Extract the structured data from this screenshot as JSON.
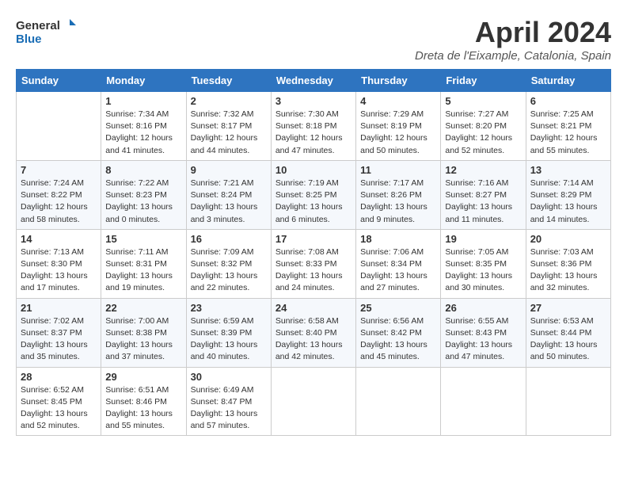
{
  "header": {
    "logo_line1": "General",
    "logo_line2": "Blue",
    "month_title": "April 2024",
    "location": "Dreta de l'Eixample, Catalonia, Spain"
  },
  "days_of_week": [
    "Sunday",
    "Monday",
    "Tuesday",
    "Wednesday",
    "Thursday",
    "Friday",
    "Saturday"
  ],
  "weeks": [
    [
      {
        "day": "",
        "sunrise": "",
        "sunset": "",
        "daylight": ""
      },
      {
        "day": "1",
        "sunrise": "Sunrise: 7:34 AM",
        "sunset": "Sunset: 8:16 PM",
        "daylight": "Daylight: 12 hours and 41 minutes."
      },
      {
        "day": "2",
        "sunrise": "Sunrise: 7:32 AM",
        "sunset": "Sunset: 8:17 PM",
        "daylight": "Daylight: 12 hours and 44 minutes."
      },
      {
        "day": "3",
        "sunrise": "Sunrise: 7:30 AM",
        "sunset": "Sunset: 8:18 PM",
        "daylight": "Daylight: 12 hours and 47 minutes."
      },
      {
        "day": "4",
        "sunrise": "Sunrise: 7:29 AM",
        "sunset": "Sunset: 8:19 PM",
        "daylight": "Daylight: 12 hours and 50 minutes."
      },
      {
        "day": "5",
        "sunrise": "Sunrise: 7:27 AM",
        "sunset": "Sunset: 8:20 PM",
        "daylight": "Daylight: 12 hours and 52 minutes."
      },
      {
        "day": "6",
        "sunrise": "Sunrise: 7:25 AM",
        "sunset": "Sunset: 8:21 PM",
        "daylight": "Daylight: 12 hours and 55 minutes."
      }
    ],
    [
      {
        "day": "7",
        "sunrise": "Sunrise: 7:24 AM",
        "sunset": "Sunset: 8:22 PM",
        "daylight": "Daylight: 12 hours and 58 minutes."
      },
      {
        "day": "8",
        "sunrise": "Sunrise: 7:22 AM",
        "sunset": "Sunset: 8:23 PM",
        "daylight": "Daylight: 13 hours and 0 minutes."
      },
      {
        "day": "9",
        "sunrise": "Sunrise: 7:21 AM",
        "sunset": "Sunset: 8:24 PM",
        "daylight": "Daylight: 13 hours and 3 minutes."
      },
      {
        "day": "10",
        "sunrise": "Sunrise: 7:19 AM",
        "sunset": "Sunset: 8:25 PM",
        "daylight": "Daylight: 13 hours and 6 minutes."
      },
      {
        "day": "11",
        "sunrise": "Sunrise: 7:17 AM",
        "sunset": "Sunset: 8:26 PM",
        "daylight": "Daylight: 13 hours and 9 minutes."
      },
      {
        "day": "12",
        "sunrise": "Sunrise: 7:16 AM",
        "sunset": "Sunset: 8:27 PM",
        "daylight": "Daylight: 13 hours and 11 minutes."
      },
      {
        "day": "13",
        "sunrise": "Sunrise: 7:14 AM",
        "sunset": "Sunset: 8:29 PM",
        "daylight": "Daylight: 13 hours and 14 minutes."
      }
    ],
    [
      {
        "day": "14",
        "sunrise": "Sunrise: 7:13 AM",
        "sunset": "Sunset: 8:30 PM",
        "daylight": "Daylight: 13 hours and 17 minutes."
      },
      {
        "day": "15",
        "sunrise": "Sunrise: 7:11 AM",
        "sunset": "Sunset: 8:31 PM",
        "daylight": "Daylight: 13 hours and 19 minutes."
      },
      {
        "day": "16",
        "sunrise": "Sunrise: 7:09 AM",
        "sunset": "Sunset: 8:32 PM",
        "daylight": "Daylight: 13 hours and 22 minutes."
      },
      {
        "day": "17",
        "sunrise": "Sunrise: 7:08 AM",
        "sunset": "Sunset: 8:33 PM",
        "daylight": "Daylight: 13 hours and 24 minutes."
      },
      {
        "day": "18",
        "sunrise": "Sunrise: 7:06 AM",
        "sunset": "Sunset: 8:34 PM",
        "daylight": "Daylight: 13 hours and 27 minutes."
      },
      {
        "day": "19",
        "sunrise": "Sunrise: 7:05 AM",
        "sunset": "Sunset: 8:35 PM",
        "daylight": "Daylight: 13 hours and 30 minutes."
      },
      {
        "day": "20",
        "sunrise": "Sunrise: 7:03 AM",
        "sunset": "Sunset: 8:36 PM",
        "daylight": "Daylight: 13 hours and 32 minutes."
      }
    ],
    [
      {
        "day": "21",
        "sunrise": "Sunrise: 7:02 AM",
        "sunset": "Sunset: 8:37 PM",
        "daylight": "Daylight: 13 hours and 35 minutes."
      },
      {
        "day": "22",
        "sunrise": "Sunrise: 7:00 AM",
        "sunset": "Sunset: 8:38 PM",
        "daylight": "Daylight: 13 hours and 37 minutes."
      },
      {
        "day": "23",
        "sunrise": "Sunrise: 6:59 AM",
        "sunset": "Sunset: 8:39 PM",
        "daylight": "Daylight: 13 hours and 40 minutes."
      },
      {
        "day": "24",
        "sunrise": "Sunrise: 6:58 AM",
        "sunset": "Sunset: 8:40 PM",
        "daylight": "Daylight: 13 hours and 42 minutes."
      },
      {
        "day": "25",
        "sunrise": "Sunrise: 6:56 AM",
        "sunset": "Sunset: 8:42 PM",
        "daylight": "Daylight: 13 hours and 45 minutes."
      },
      {
        "day": "26",
        "sunrise": "Sunrise: 6:55 AM",
        "sunset": "Sunset: 8:43 PM",
        "daylight": "Daylight: 13 hours and 47 minutes."
      },
      {
        "day": "27",
        "sunrise": "Sunrise: 6:53 AM",
        "sunset": "Sunset: 8:44 PM",
        "daylight": "Daylight: 13 hours and 50 minutes."
      }
    ],
    [
      {
        "day": "28",
        "sunrise": "Sunrise: 6:52 AM",
        "sunset": "Sunset: 8:45 PM",
        "daylight": "Daylight: 13 hours and 52 minutes."
      },
      {
        "day": "29",
        "sunrise": "Sunrise: 6:51 AM",
        "sunset": "Sunset: 8:46 PM",
        "daylight": "Daylight: 13 hours and 55 minutes."
      },
      {
        "day": "30",
        "sunrise": "Sunrise: 6:49 AM",
        "sunset": "Sunset: 8:47 PM",
        "daylight": "Daylight: 13 hours and 57 minutes."
      },
      {
        "day": "",
        "sunrise": "",
        "sunset": "",
        "daylight": ""
      },
      {
        "day": "",
        "sunrise": "",
        "sunset": "",
        "daylight": ""
      },
      {
        "day": "",
        "sunrise": "",
        "sunset": "",
        "daylight": ""
      },
      {
        "day": "",
        "sunrise": "",
        "sunset": "",
        "daylight": ""
      }
    ]
  ]
}
